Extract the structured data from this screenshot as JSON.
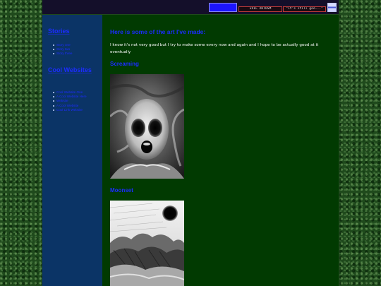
{
  "top_bar": {
    "badge_left": "EVIL AUTOSM",
    "badge_right": "\"it's still goo...\""
  },
  "sidebar": {
    "section1_title": "Stories",
    "section1_items": [
      "Story one",
      "Story two",
      "Story three"
    ],
    "section2_title": "Cool Websites",
    "section2_items": [
      "Cool Website One",
      "A Cool Website Here",
      "Website",
      "A Cool Website",
      "Cool Link Website"
    ]
  },
  "main": {
    "heading": "Here is some of the art I've made:",
    "intro": "I know it's not very good but I try to make some every now and again and I hope to be actually good at it eventually",
    "artworks": [
      {
        "title": "Screaming"
      },
      {
        "title": "Moonset"
      }
    ]
  },
  "colors": {
    "link_blue": "#1c2cff",
    "sidebar_bg": "#0b3466",
    "main_bg": "#013a01",
    "topbar_bg": "#140f2a"
  }
}
